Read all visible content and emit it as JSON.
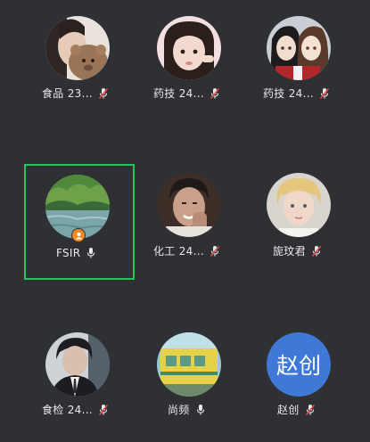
{
  "participants": [
    {
      "name": "食品 23...",
      "mic": "muted",
      "avatar": "photo-girl-with-bear",
      "colors": [
        "#e9e3dc",
        "#9a7456",
        "#3b2b24"
      ]
    },
    {
      "name": "药技 24...",
      "mic": "muted",
      "avatar": "photo-girl-pink",
      "colors": [
        "#f3dfe2",
        "#2b1f1c",
        "#e8c3c4"
      ]
    },
    {
      "name": "药技 24...",
      "mic": "muted",
      "avatar": "photo-anime-pair",
      "colors": [
        "#c9cdd4",
        "#5a3a2b",
        "#b3272b"
      ]
    },
    {
      "name": "FSIR",
      "mic": "on",
      "host": true,
      "avatar": "photo-landscape-lake",
      "colors": [
        "#6da14a",
        "#3a6a3a",
        "#8fb8c4"
      ]
    },
    {
      "name": "化工 24...",
      "mic": "muted",
      "avatar": "photo-boy-smiling",
      "colors": [
        "#3e2e28",
        "#c9a08b",
        "#1f1a18"
      ]
    },
    {
      "name": "旎玟君",
      "mic": "muted",
      "avatar": "photo-blond-boy",
      "colors": [
        "#d8d5cf",
        "#e4c77d",
        "#f0d8c8"
      ]
    },
    {
      "name": "食检 24...",
      "mic": "muted",
      "avatar": "photo-boy-suit",
      "colors": [
        "#ccd2d6",
        "#1b1d21",
        "#54606a"
      ]
    },
    {
      "name": "尚频",
      "mic": "on",
      "avatar": "photo-train-yellow",
      "colors": [
        "#e6d24a",
        "#9bc9cf",
        "#5d9a84"
      ]
    },
    {
      "name": "赵创",
      "mic": "muted",
      "avatar": "text",
      "initials": "赵创",
      "colors": [
        "#3f78d6"
      ]
    }
  ],
  "active_speaker": "FSIR",
  "accent_active": "#2fbf5a",
  "mic_icon_colors": {
    "on": "#e9e9eb",
    "muted": "#e9e9eb",
    "muted_slash": "#e04848"
  }
}
